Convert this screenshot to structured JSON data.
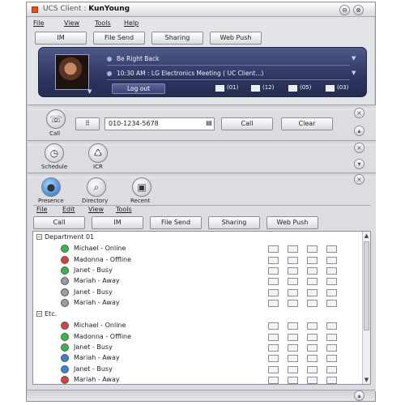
{
  "window": {
    "title_prefix": "UCS Client :",
    "title_user": "KunYoung",
    "minimize_glyph": "⊖",
    "close_glyph": "⊗"
  },
  "menu": [
    "File",
    "View",
    "Tools",
    "Help"
  ],
  "toolbar": [
    "IM",
    "File Send",
    "Sharing",
    "Web Push"
  ],
  "profile": {
    "status_text": "Be Right Back",
    "schedule_text": "10:30 AM : LG Electronics  Meeting ( UC Client...)",
    "logout_label": "Log out",
    "stats": [
      {
        "icon": "call-log-icon",
        "count": "(01)"
      },
      {
        "icon": "message-icon",
        "count": "(12)"
      },
      {
        "icon": "mail-icon",
        "count": "(05)"
      },
      {
        "icon": "voicemail-icon",
        "count": "(03)"
      }
    ]
  },
  "call_panel": {
    "call_icon_label": "Call",
    "phone_number": "010-1234-5678",
    "call_button": "Call",
    "clear_button": "Clear"
  },
  "schedule_panel": {
    "items": [
      {
        "label": "Schedule",
        "icon": "clock-icon"
      },
      {
        "label": "ICR",
        "icon": "icr-icon"
      }
    ]
  },
  "contacts_panel": {
    "tabs": [
      {
        "label": "Presence",
        "icon": "presence-icon"
      },
      {
        "label": "Directory",
        "icon": "directory-icon"
      },
      {
        "label": "Recent",
        "icon": "recent-icon"
      }
    ],
    "menu": [
      "File",
      "Edit",
      "View",
      "Tools"
    ],
    "toolbar": [
      "Call",
      "IM",
      "File Send",
      "Sharing",
      "Web Push"
    ],
    "groups": [
      {
        "name": "Department 01",
        "contacts": [
          {
            "name": "Michael - Online",
            "status_color": "#3bb54a"
          },
          {
            "name": "Madonna - Offline",
            "status_color": "#d94040"
          },
          {
            "name": "Janet - Busy",
            "status_color": "#3bb54a"
          },
          {
            "name": "Mariah - Away",
            "status_color": "#9a9ca2"
          },
          {
            "name": "Janet - Busy",
            "status_color": "#9a9ca2"
          },
          {
            "name": "Mariah - Away",
            "status_color": "#9a9ca2"
          }
        ]
      },
      {
        "name": "Etc.",
        "contacts": [
          {
            "name": "Michael - Online",
            "status_color": "#d94040"
          },
          {
            "name": "Madonna - Offline",
            "status_color": "#3bb54a"
          },
          {
            "name": "Janet - Busy",
            "status_color": "#3bb54a"
          },
          {
            "name": "Mariah - Away",
            "status_color": "#3a84d8"
          },
          {
            "name": "Janet - Busy",
            "status_color": "#3a84d8"
          },
          {
            "name": "Mariah - Away",
            "status_color": "#d94040"
          }
        ]
      }
    ]
  }
}
